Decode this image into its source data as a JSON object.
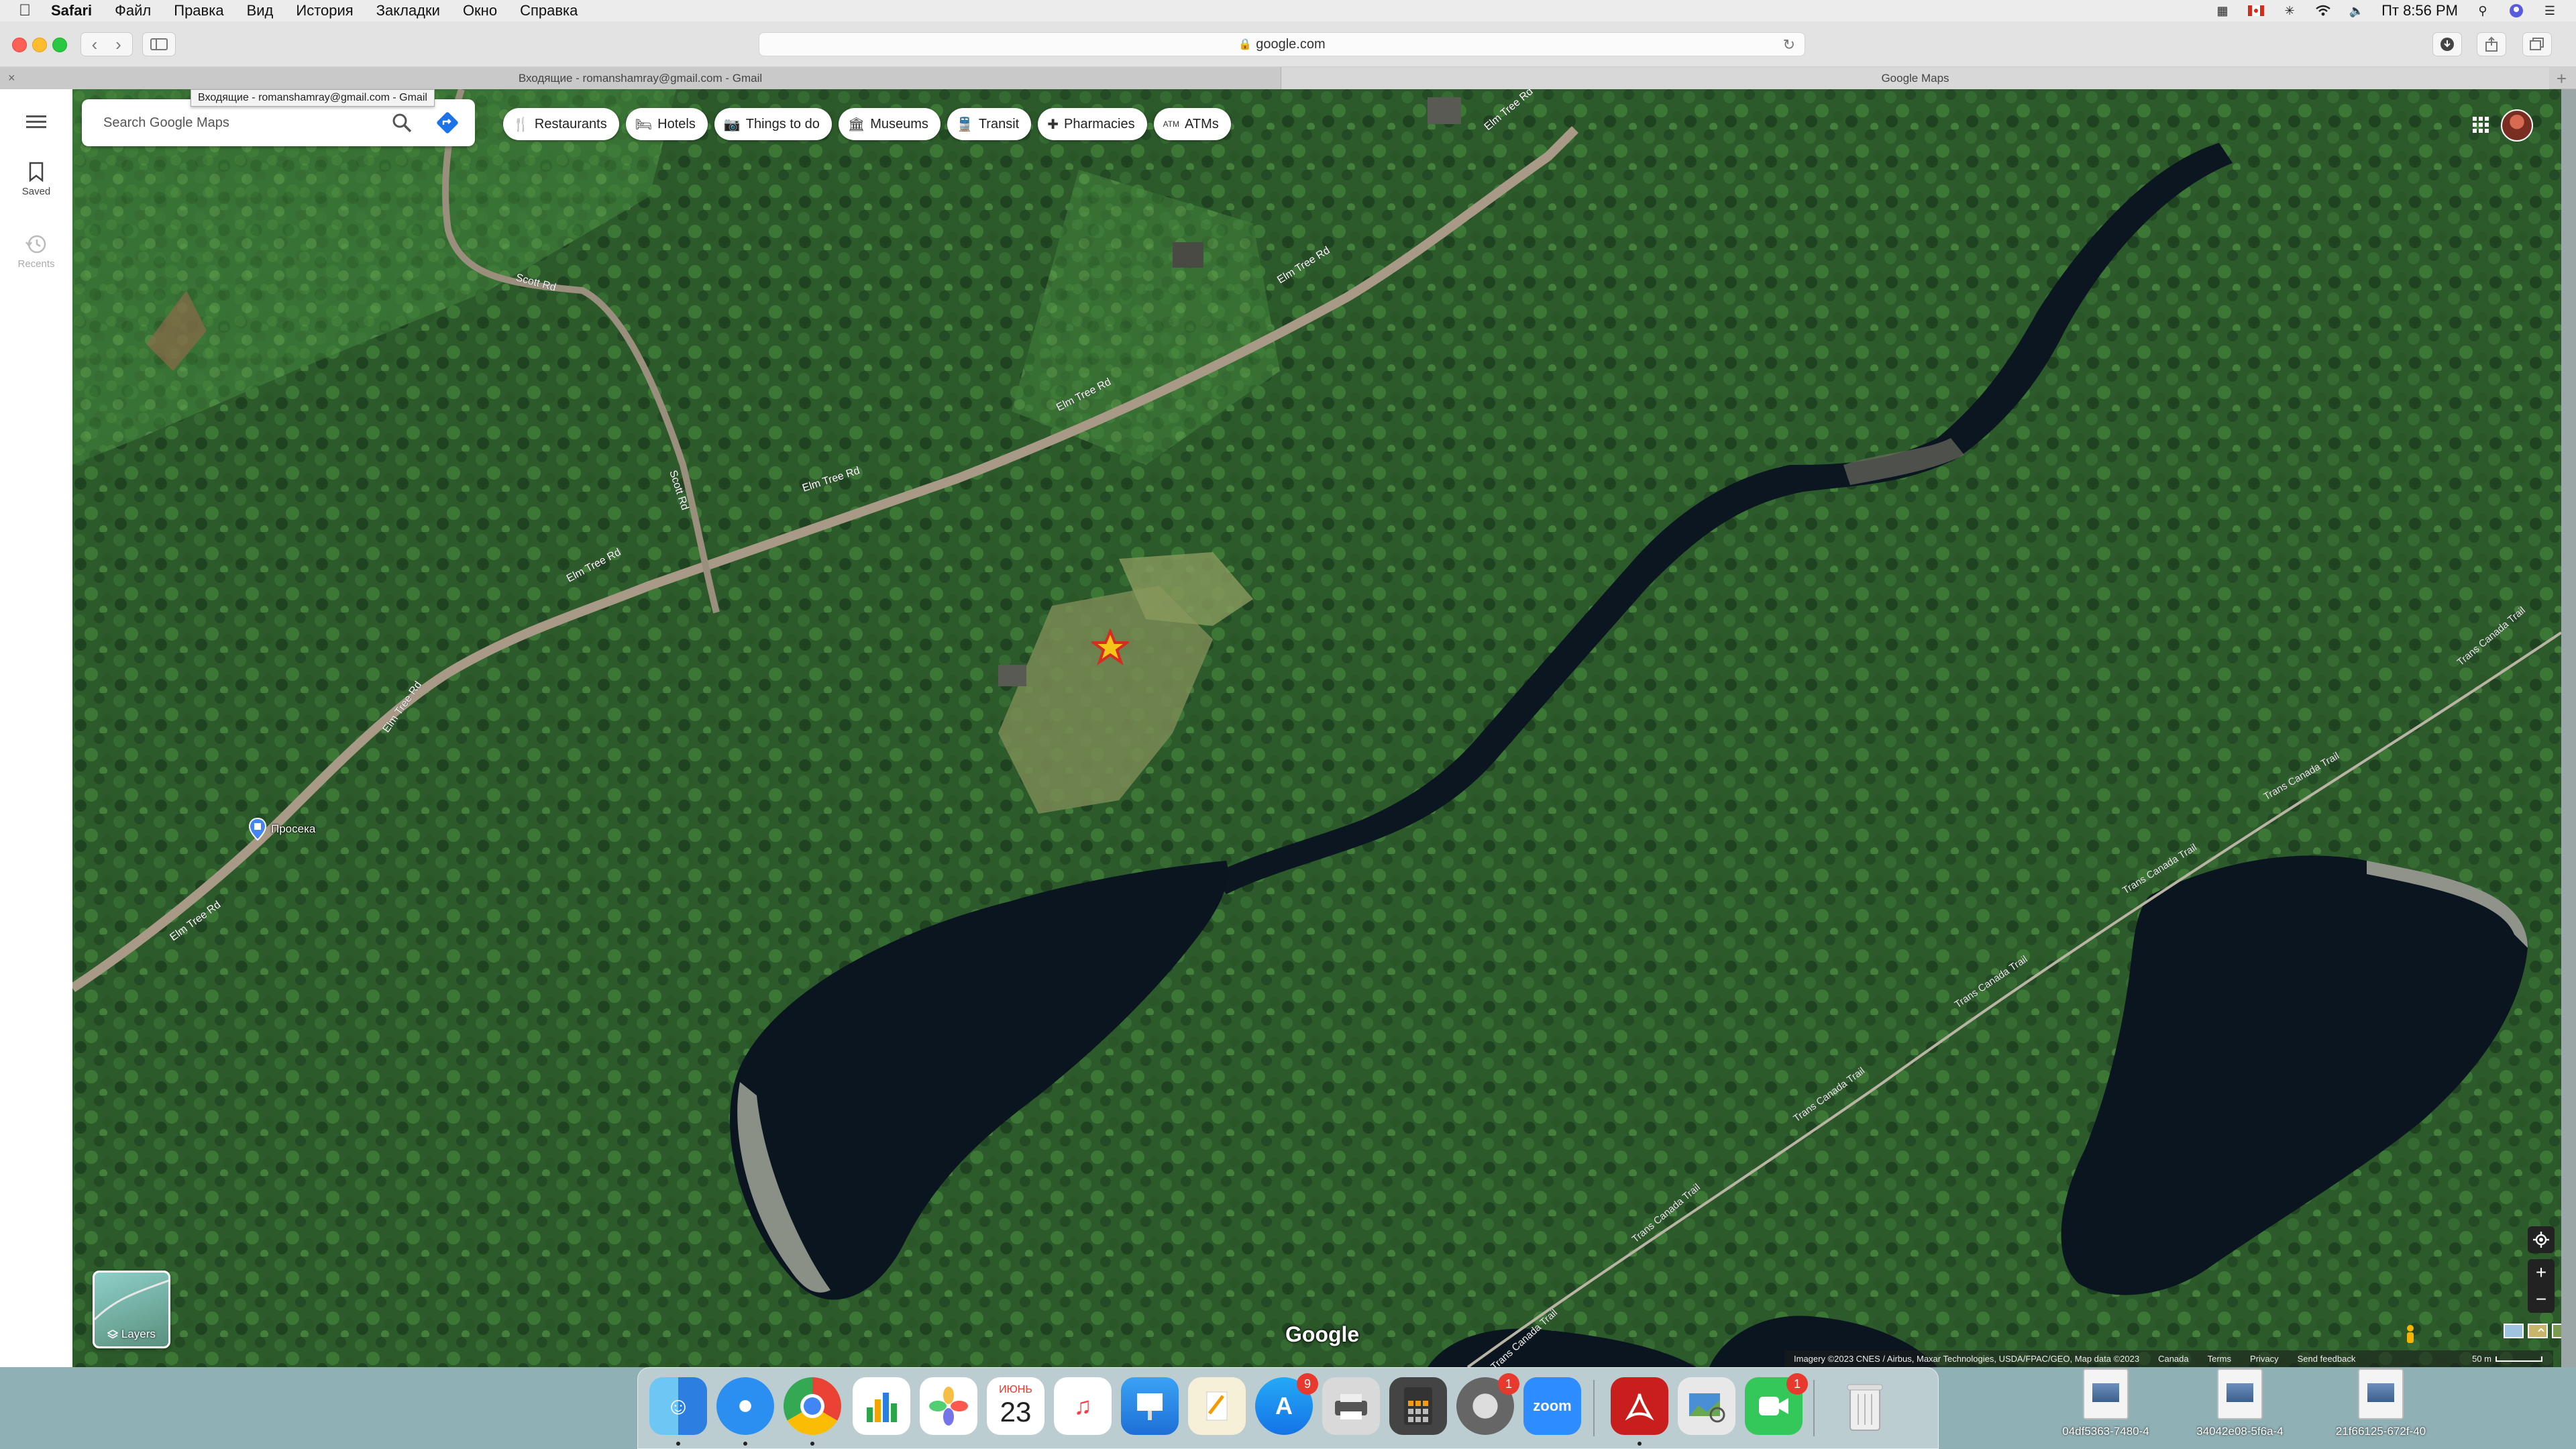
{
  "menubar": {
    "app": "Safari",
    "items": [
      "Файл",
      "Правка",
      "Вид",
      "История",
      "Закладки",
      "Окно",
      "Справка"
    ],
    "clock": "Пт 8:56 PM"
  },
  "browser": {
    "address": "google.com",
    "tabs": [
      {
        "title": "Входящие - romanshamray@gmail.com - Gmail"
      },
      {
        "title": "Google Maps"
      }
    ],
    "tooltip": "Входящие - romanshamray@gmail.com - Gmail"
  },
  "sidebar": {
    "items": [
      {
        "label": "Saved",
        "icon": "bookmark-icon"
      },
      {
        "label": "Recents",
        "icon": "history-icon"
      }
    ]
  },
  "search": {
    "placeholder": "Search Google Maps"
  },
  "chips": [
    {
      "label": "Restaurants",
      "icon": "utensils-icon"
    },
    {
      "label": "Hotels",
      "icon": "bed-icon"
    },
    {
      "label": "Things to do",
      "icon": "camera-icon"
    },
    {
      "label": "Museums",
      "icon": "museum-icon"
    },
    {
      "label": "Transit",
      "icon": "train-icon"
    },
    {
      "label": "Pharmacies",
      "icon": "pharmacy-icon"
    },
    {
      "label": "ATMs",
      "icon": "atm-icon"
    }
  ],
  "map": {
    "road_labels": [
      "Elm Tree Rd",
      "Elm Tree Rd",
      "Elm Tree Rd",
      "Elm Tree Rd",
      "Elm Tree Rd",
      "Elm Tree Rd",
      "Elm Tree Rd",
      "Scott Rd",
      "Scott Rd"
    ],
    "trail_labels": [
      "Trans Canada Trail",
      "Trans Canada Trail",
      "Trans Canada Trail",
      "Trans Canada Trail",
      "Trans Canada Trail",
      "Trans Canada Trail",
      "Trans Canada Trail"
    ],
    "place_label": "Просека",
    "layers_label": "Layers",
    "logo": "Google",
    "colors": {
      "forest": "#2d5a2d",
      "water": "#0a1620",
      "road": "#a89a86"
    }
  },
  "footer": {
    "imagery": "Imagery ©2023 CNES / Airbus, Maxar Technologies, USDA/FPAC/GEO, Map data ©2023",
    "country": "Canada",
    "terms": "Terms",
    "privacy": "Privacy",
    "feedback": "Send feedback",
    "scale": "50 m"
  },
  "dock": {
    "calendar_month": "ИЮНЬ",
    "calendar_day": "23",
    "appstore_badge": "9",
    "prefs_badge": "1",
    "facetime_badge": "1",
    "zoom_label": "zoom"
  },
  "desktop_files": [
    {
      "name": "04df5363-7480-4"
    },
    {
      "name": "34042e08-5f6a-4"
    },
    {
      "name": "21f66125-672f-40"
    }
  ]
}
